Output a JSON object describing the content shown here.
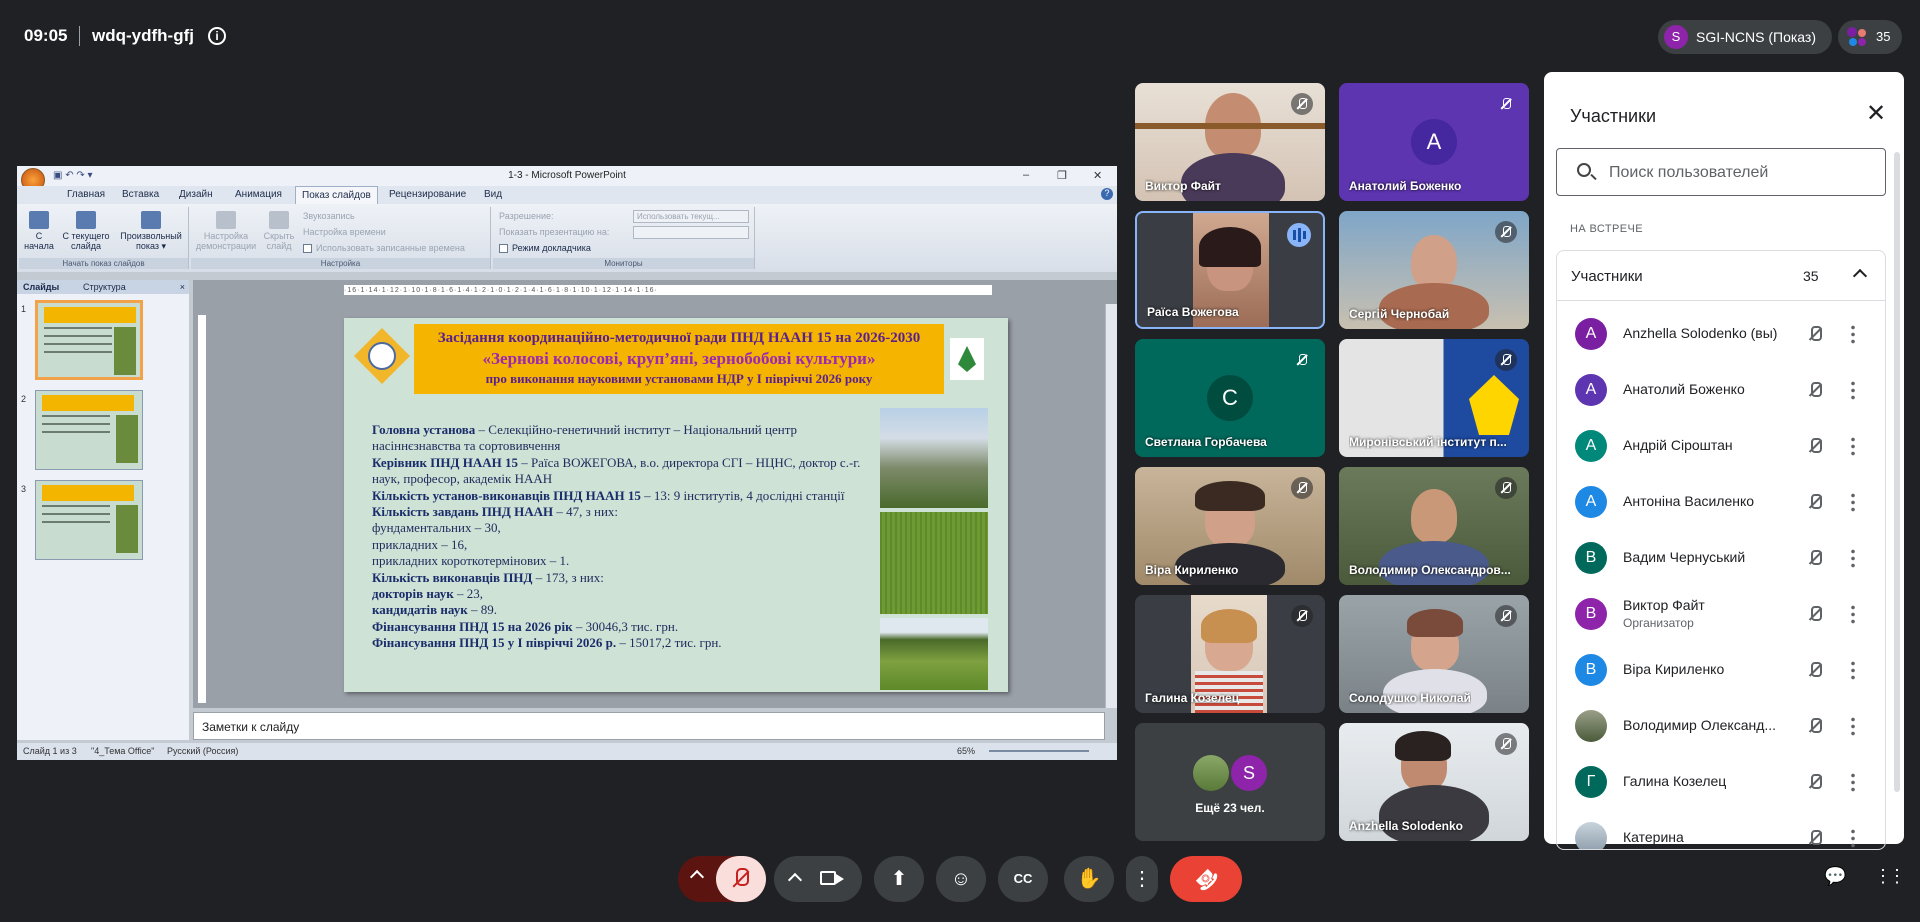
{
  "topbar": {
    "time": "09:05",
    "meeting_code": "wdq-ydfh-gfj",
    "presenter": {
      "initial": "S",
      "label": "SGI-NCNS (Показ)",
      "color": "#8e24aa"
    },
    "participant_count": "35"
  },
  "ppt": {
    "window_title": "1-3 - Microsoft PowerPoint",
    "tabs": [
      "Главная",
      "Вставка",
      "Дизайн",
      "Анимация",
      "Показ слайдов",
      "Рецензирование",
      "Вид"
    ],
    "active_tab": "Показ слайдов",
    "ribbon": {
      "from_start": [
        "С",
        "начала"
      ],
      "from_current": [
        "С текущего",
        "слайда"
      ],
      "custom_show": [
        "Произвольный",
        "показ"
      ],
      "group1": "Начать показ слайдов",
      "setup_show": [
        "Настройка",
        "демонстрации"
      ],
      "hide_slide": [
        "Скрыть",
        "слайд"
      ],
      "record": "Звукозапись",
      "rehearse": "Настройка времени",
      "use_timings": "Использовать записанные времена",
      "group2": "Настройка",
      "resolution": "Разрешение:",
      "resolution_value": "Использовать текущ...",
      "show_on": "Показать презентацию на:",
      "presenter_view": "Режим докладчика",
      "group3": "Мониторы"
    },
    "pane_tabs": [
      "Слайды",
      "Структура"
    ],
    "thumb_numbers": [
      "1",
      "2",
      "3"
    ],
    "ruler": "·16·1·14·1·12·1·10·1·8·1·6·1·4·1·2·1·0·1·2·1·4·1·6·1·8·1·10·1·12·1·14·1·16·",
    "slide": {
      "header_line1": "Засідання  координаційно-методичної ради ПНД НААН 15 на 2026-2030",
      "header_line2": "«Зернові колосові, круп’яні, зернобобові культури»",
      "header_line3": "про виконання науковими установами НДР у І півріччі 2026 року",
      "body": [
        {
          "b": "Головна установа",
          "t": " – Селекційно-генетичний інститут – Національний центр насіннєзнавства та сортовивчення"
        },
        {
          "b": "Керівник ПНД НААН 15",
          "t": " – Раїса ВОЖЕГОВА, в.о. директора СГІ – НЦНС, доктор с.-г. наук, професор, академік НААН"
        },
        {
          "b": "Кількість установ-виконавців ПНД НААН 15",
          "t": " – 13: 9 інститутів, 4 дослідні станції"
        },
        {
          "b": "Кількість завдань ПНД НААН",
          "t": " – 47, з них:"
        },
        {
          "b": "",
          "t": "фундаментальних – 30,"
        },
        {
          "b": "",
          "t": "прикладних – 16,"
        },
        {
          "b": "",
          "t": "прикладних короткотермінових – 1."
        },
        {
          "b": "Кількість виконавців ПНД",
          "t": " – 173, з них:"
        },
        {
          "b": "докторів наук",
          "t": " – 23,"
        },
        {
          "b": "кандидатів наук",
          "t": " – 89."
        },
        {
          "b": "Фінансування ПНД 15 на 2026 рік",
          "t": " – 30046,3 тис. грн."
        },
        {
          "b": "Фінансування ПНД 15 у І півріччі  2026 р.",
          "t": " – 15017,2 тис. грн."
        }
      ]
    },
    "notes_placeholder": "Заметки к слайду",
    "status": {
      "slide": "Слайд 1 из 3",
      "theme": "\"4_Тема Office\"",
      "lang": "Русский (Россия)",
      "zoom": "65%"
    }
  },
  "tiles": [
    {
      "name": "Виктор Файт",
      "muted": true,
      "type": "video"
    },
    {
      "name": "Анатолий Боженко",
      "muted": true,
      "type": "avatar",
      "initial": "А",
      "bg": "#5e35b1",
      "avbg": "#4527a0"
    },
    {
      "name": "Раїса Вожегова",
      "muted": false,
      "type": "video",
      "speaking": true
    },
    {
      "name": "Сергій Чернобай",
      "muted": true,
      "type": "video"
    },
    {
      "name": "Светлана Горбачева",
      "muted": true,
      "type": "avatar",
      "initial": "С",
      "bg": "#00695c",
      "avbg": "#004d40"
    },
    {
      "name": "Миронівський інститут п...",
      "muted": true,
      "type": "video"
    },
    {
      "name": "Віра Кириленко",
      "muted": true,
      "type": "video"
    },
    {
      "name": "Володимир Олександров...",
      "muted": true,
      "type": "video"
    },
    {
      "name": "Галина Козелец",
      "muted": true,
      "type": "video"
    },
    {
      "name": "Солодушко Николай",
      "muted": true,
      "type": "video"
    },
    {
      "name": "Ещё 23 чел.",
      "muted": false,
      "type": "more",
      "initial": "S"
    },
    {
      "name": "Anzhella Solodenko",
      "muted": true,
      "type": "video"
    }
  ],
  "panel": {
    "title": "Участники",
    "search_placeholder": "Поиск пользователей",
    "section": "НА ВСТРЕЧЕ",
    "group_title": "Участники",
    "group_count": "35",
    "people": [
      {
        "initial": "A",
        "name": "Anzhella Solodenko (вы)",
        "color": "#7b1fa2"
      },
      {
        "initial": "А",
        "name": "Анатолий Боженко",
        "color": "#5e35b1"
      },
      {
        "initial": "А",
        "name": "Андрій Сіроштан",
        "color": "#00897b"
      },
      {
        "initial": "А",
        "name": "Антоніна Василенко",
        "color": "#1e88e5"
      },
      {
        "initial": "В",
        "name": "Вадим Чернуський",
        "color": "#00695c"
      },
      {
        "initial": "В",
        "name": "Виктор Файт",
        "color": "#8e24aa",
        "role": "Организатор"
      },
      {
        "initial": "В",
        "name": "Віра Кириленко",
        "color": "#1e88e5"
      },
      {
        "initial": "",
        "name": "Володимир Олександ...",
        "color": "#6d7a5a"
      },
      {
        "initial": "Г",
        "name": "Галина Козелец",
        "color": "#00695c"
      },
      {
        "initial": "",
        "name": "Катерина",
        "color": "#8a9aa8"
      }
    ]
  },
  "controls": {
    "present": "⬆",
    "emoji": "☺",
    "cc": "CC",
    "hand": "✋",
    "more": "⋮",
    "hangup": "☎",
    "chat": "💬",
    "apps": "⋮⋮"
  }
}
